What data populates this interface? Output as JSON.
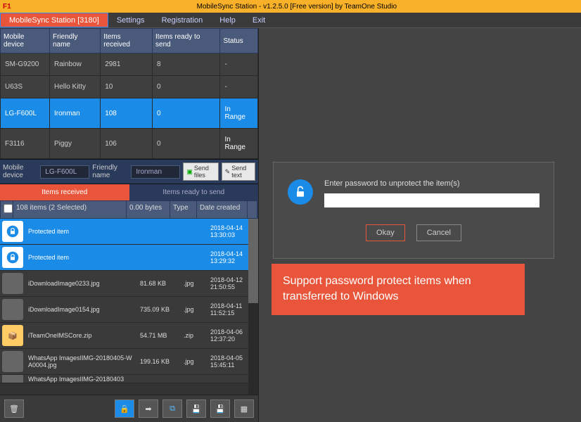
{
  "titlebar": {
    "icon": "F1",
    "title": "MobileSync Station - v1.2.5.0 [Free version] by TeamOne Studio"
  },
  "menu": {
    "main": "MobileSync Station [3180]",
    "settings": "Settings",
    "registration": "Registration",
    "help": "Help",
    "exit": "Exit"
  },
  "devcols": {
    "c1": "Mobile device",
    "c2": "Friendly name",
    "c3": "Items received",
    "c4": "Items ready to send",
    "c5": "Status"
  },
  "devices": [
    {
      "id": "SM-G9200",
      "name": "Rainbow",
      "recv": "2981",
      "send": "8",
      "status": "-"
    },
    {
      "id": "U63S",
      "name": "Hello Kitty",
      "recv": "10",
      "send": "0",
      "status": "-"
    },
    {
      "id": "LG-F600L",
      "name": "Ironman",
      "recv": "108",
      "send": "0",
      "status": "In Range"
    },
    {
      "id": "F3116",
      "name": "Piggy",
      "recv": "106",
      "send": "0",
      "status": "In Range"
    }
  ],
  "devbar": {
    "l1": "Mobile device",
    "v1": "LG-F600L",
    "l2": "Friendly name",
    "v2": "Ironman",
    "sendfiles": "Send files",
    "sendtext": "Send text"
  },
  "tabs": {
    "recv": "Items received",
    "send": "Items ready to send"
  },
  "itemhead": {
    "summary": "108 items (2 Selected)",
    "size": "0.00 bytes",
    "type": "Type",
    "date": "Date created"
  },
  "items": [
    {
      "name": "Protected item",
      "size": "",
      "type": "",
      "date": "2018-04-14 13:30:03",
      "lock": true,
      "sel": true
    },
    {
      "name": "Protected item",
      "size": "",
      "type": "",
      "date": "2018-04-14 13:29:32",
      "lock": true,
      "sel": true
    },
    {
      "name": "iDownloadImage0233.jpg",
      "size": "81.68 KB",
      "type": ".jpg",
      "date": "2018-04-12 21:50:55"
    },
    {
      "name": "iDownloadImage0154.jpg",
      "size": "735.09 KB",
      "type": ".jpg",
      "date": "2018-04-11 11:52:15"
    },
    {
      "name": "iTeamOneIMSCore.zip",
      "size": "54.71 MB",
      "type": ".zip",
      "date": "2018-04-06 12:37:20"
    },
    {
      "name": "WhatsApp ImagesIIMG-20180405-WA0004.jpg",
      "size": "199.16 KB",
      "type": ".jpg",
      "date": "2018-04-05 15:45:11"
    },
    {
      "name": "WhatsApp ImagesIIMG-20180403",
      "size": "",
      "type": "",
      "date": ""
    }
  ],
  "dialog": {
    "msg": "Enter password to unprotect the item(s)",
    "ok": "Okay",
    "cancel": "Cancel"
  },
  "callout": "Support password protect items when transferred to Windows"
}
